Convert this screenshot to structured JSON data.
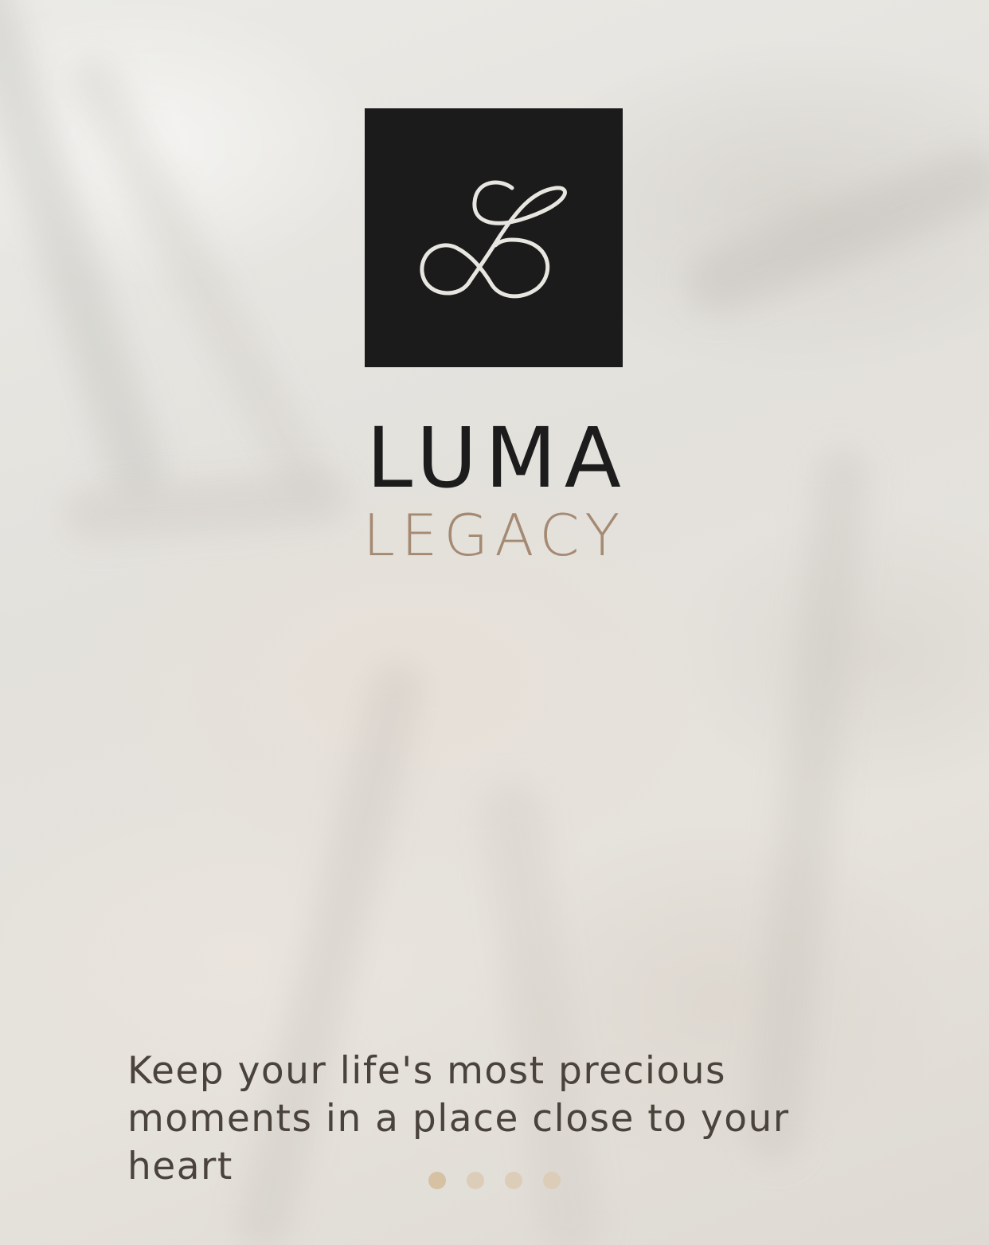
{
  "brand": {
    "name": "LUMA",
    "subtitle": "LEGACY",
    "logo_icon": "infinity-letter-l-logo-icon"
  },
  "onboarding": {
    "tagline": "Keep your life's most precious moments in a place close to your heart",
    "page_count": 4,
    "active_page": 1
  },
  "colors": {
    "logo_background": "#1b1b1b",
    "logo_stroke": "#e8e6e1",
    "name_color": "#1c1c1c",
    "subtitle_color": "#a58a73",
    "tagline_color": "#4a433c",
    "dot_active": "#d6c1a3",
    "dot_inactive": "#dccdb8"
  }
}
